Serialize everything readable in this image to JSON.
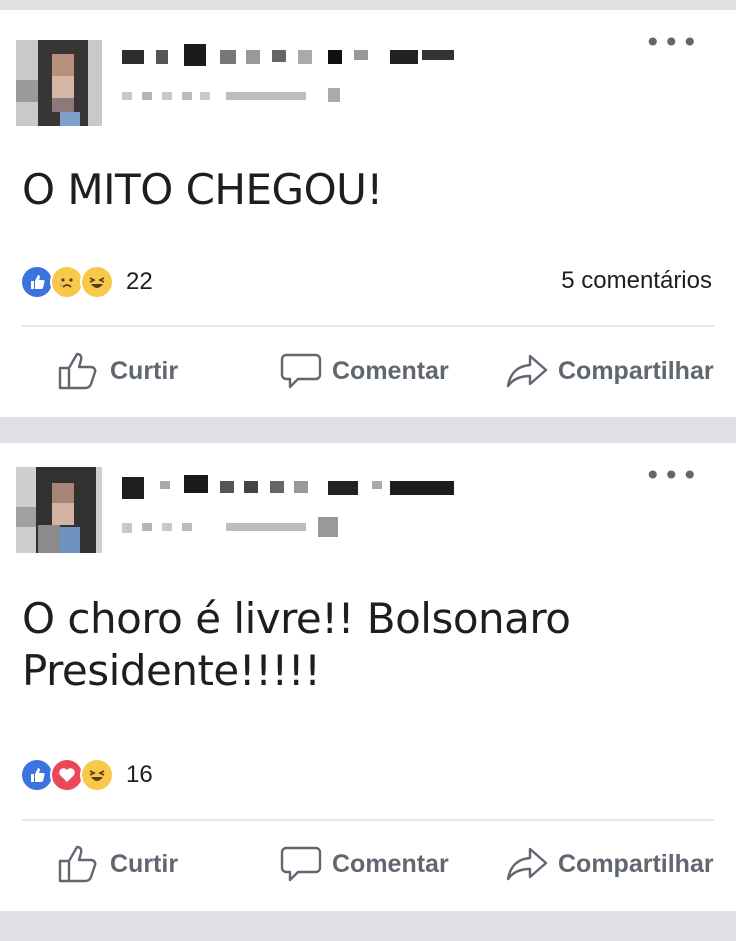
{
  "posts": [
    {
      "text": "O MITO CHEGOU!",
      "reactions": [
        "like-icon",
        "sad-icon",
        "haha-icon"
      ],
      "reaction_count": "22",
      "comments": "5 comentários",
      "actions": {
        "like": "Curtir",
        "comment": "Comentar",
        "share": "Compartilhar"
      }
    },
    {
      "text_line1": "O choro é livre!! Bolsonaro",
      "text_line2": "Presidente!!!!!",
      "reactions": [
        "like-icon",
        "love-icon",
        "haha-icon"
      ],
      "reaction_count": "16",
      "actions": {
        "like": "Curtir",
        "comment": "Comentar",
        "share": "Compartilhar"
      }
    }
  ],
  "colors": {
    "like_blue": "#3b73e0",
    "love_red": "#e9485a",
    "haha_yellow": "#f7c84a",
    "muted_text": "#606770"
  }
}
